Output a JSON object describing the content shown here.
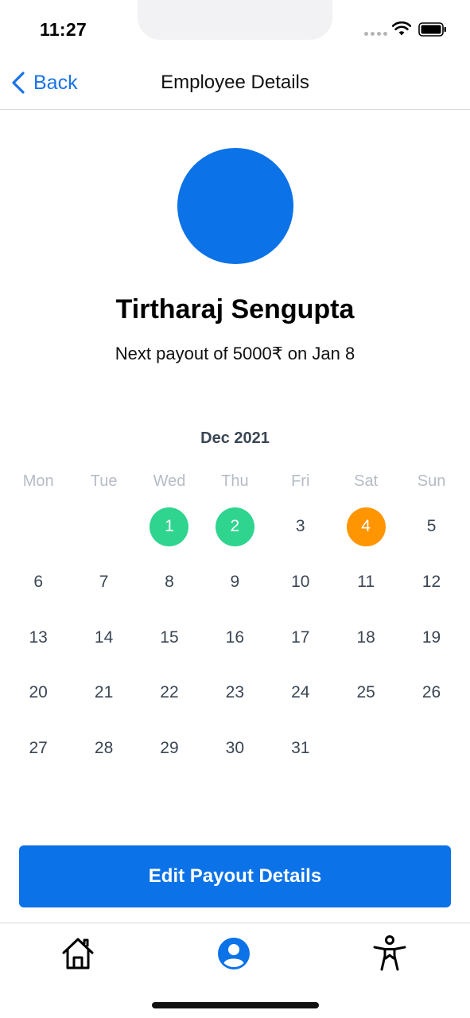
{
  "status_bar": {
    "time": "11:27"
  },
  "nav": {
    "back_label": "Back",
    "title": "Employee Details"
  },
  "profile": {
    "name": "Tirtharaj Sengupta",
    "payout_text": "Next payout of 5000₹ on Jan 8"
  },
  "calendar": {
    "month_label": "Dec 2021",
    "weekdays": [
      "Mon",
      "Tue",
      "Wed",
      "Thu",
      "Fri",
      "Sat",
      "Sun"
    ],
    "leading_blanks": 2,
    "days": [
      "1",
      "2",
      "3",
      "4",
      "5",
      "6",
      "7",
      "8",
      "9",
      "10",
      "11",
      "12",
      "13",
      "14",
      "15",
      "16",
      "17",
      "18",
      "19",
      "20",
      "21",
      "22",
      "23",
      "24",
      "25",
      "26",
      "27",
      "28",
      "29",
      "30",
      "31"
    ],
    "highlighted": {
      "1": "green",
      "2": "green",
      "4": "orange"
    }
  },
  "actions": {
    "edit_label": "Edit Payout Details"
  },
  "tab_bar": {
    "items": [
      "home-icon",
      "profile-icon",
      "accessibility-icon"
    ],
    "active": "profile-icon"
  },
  "colors": {
    "accent": "#0b72e7",
    "paid": "#2fd48f",
    "pending": "#ff9500",
    "text_muted": "#b6bcc6"
  }
}
